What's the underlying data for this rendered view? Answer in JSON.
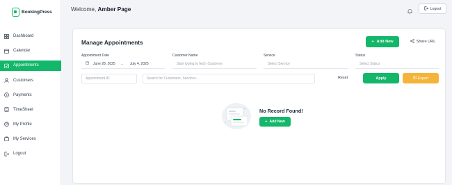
{
  "brand": {
    "name": "BookingPress",
    "logo_icon": "bookingpress-logo-icon",
    "color": "#12b76a"
  },
  "sidebar": {
    "items": [
      {
        "label": "Dashboard",
        "icon": "dashboard-icon",
        "active": false
      },
      {
        "label": "Calendar",
        "icon": "calendar-icon",
        "active": false
      },
      {
        "label": "Appointments",
        "icon": "appointments-icon",
        "active": true
      },
      {
        "label": "Customers",
        "icon": "customers-icon",
        "active": false
      },
      {
        "label": "Payments",
        "icon": "payments-icon",
        "active": false
      },
      {
        "label": "TimeSheet",
        "icon": "timesheet-icon",
        "active": false
      },
      {
        "label": "My Profile",
        "icon": "profile-icon",
        "active": false
      },
      {
        "label": "My Services",
        "icon": "services-icon",
        "active": false
      },
      {
        "label": "Logout",
        "icon": "logout-icon",
        "active": false
      }
    ]
  },
  "header": {
    "welcome_prefix": "Welcome,",
    "user_name": "Amber Page",
    "notification_icon": "bell-icon",
    "logout_label": "Logout"
  },
  "main": {
    "title": "Manage Appointments",
    "add_new_label": "Add New",
    "share_url_label": "Share URL",
    "filters": {
      "date_label": "Appointment Date",
      "date_from": "June 28, 2025",
      "date_to": "July 4, 2025",
      "customer_label": "Customer Name",
      "customer_placeholder": "Start typing to fetch Customer",
      "service_label": "Service",
      "service_placeholder": "Select Service",
      "status_label": "Status",
      "status_placeholder": "Select Status",
      "appointment_id_placeholder": "Appointment ID",
      "search_placeholder": "Search for Customers, Services...",
      "reset_label": "Reset",
      "apply_label": "Apply",
      "export_label": "Export"
    },
    "empty": {
      "title": "No Record Found!",
      "add_new_label": "Add New"
    }
  },
  "colors": {
    "accent": "#12b76a",
    "export": "#f4b43a",
    "background": "#f2f4f7"
  }
}
